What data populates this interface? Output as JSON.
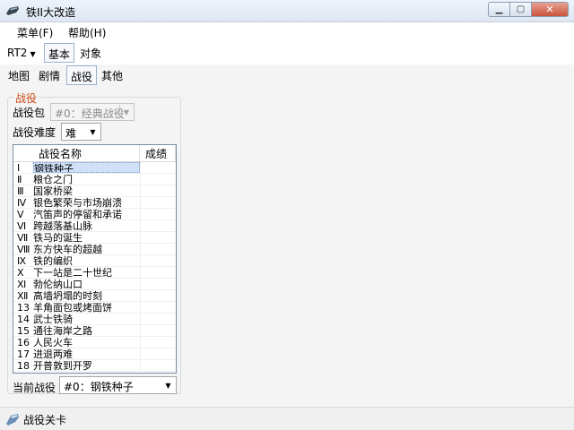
{
  "window": {
    "title": "铁II大改造",
    "min_glyph": "▁",
    "max_glyph": "▢",
    "close_glyph": "✕"
  },
  "menu": {
    "items": [
      "菜单(F)",
      "帮助(H)"
    ]
  },
  "toolbar1": {
    "rt_label": "RT2",
    "rt_arrow": "▼",
    "tab_basic": "基本",
    "tab_object": "对象"
  },
  "toolbar2": {
    "tabs": [
      "地图",
      "剧情",
      "战役",
      "其他"
    ],
    "active_index": 2
  },
  "campaign_group": {
    "title": "战役",
    "pack_label": "战役包",
    "pack_value": "#0：经典战役",
    "difficulty_label": "战役难度",
    "difficulty_value": "难",
    "list": {
      "col_name": "战役名称",
      "col_score": "成绩",
      "rows": [
        {
          "num": "Ⅰ",
          "name": "钢铁种子",
          "score": ""
        },
        {
          "num": "Ⅱ",
          "name": "粮仓之门",
          "score": ""
        },
        {
          "num": "Ⅲ",
          "name": "国家桥梁",
          "score": ""
        },
        {
          "num": "Ⅳ",
          "name": "银色繁荣与市场崩溃",
          "score": ""
        },
        {
          "num": "Ⅴ",
          "name": "汽笛声的停留和承诺",
          "score": ""
        },
        {
          "num": "Ⅵ",
          "name": "跨越落基山脉",
          "score": ""
        },
        {
          "num": "Ⅶ",
          "name": "铁马的诞生",
          "score": ""
        },
        {
          "num": "Ⅷ",
          "name": "东方快车的超越",
          "score": ""
        },
        {
          "num": "Ⅸ",
          "name": "铁的编织",
          "score": ""
        },
        {
          "num": "Ⅹ",
          "name": "下一站是二十世纪",
          "score": ""
        },
        {
          "num": "Ⅺ",
          "name": "勃伦纳山口",
          "score": ""
        },
        {
          "num": "Ⅻ",
          "name": "高墙坍塌的时刻",
          "score": ""
        },
        {
          "num": "13",
          "name": "羊角面包或烤面饼",
          "score": ""
        },
        {
          "num": "14",
          "name": "武士铁骑",
          "score": ""
        },
        {
          "num": "15",
          "name": "通往海岸之路",
          "score": ""
        },
        {
          "num": "16",
          "name": "人民火车",
          "score": ""
        },
        {
          "num": "17",
          "name": "进退两难",
          "score": ""
        },
        {
          "num": "18",
          "name": "开普敦到开罗",
          "score": ""
        }
      ]
    },
    "current_label": "当前战役",
    "current_value": "#0：钢铁种子"
  },
  "status": {
    "text": "战役关卡"
  },
  "colors": {
    "accent": "#cc4a12",
    "selection": "#cfe0f7"
  }
}
